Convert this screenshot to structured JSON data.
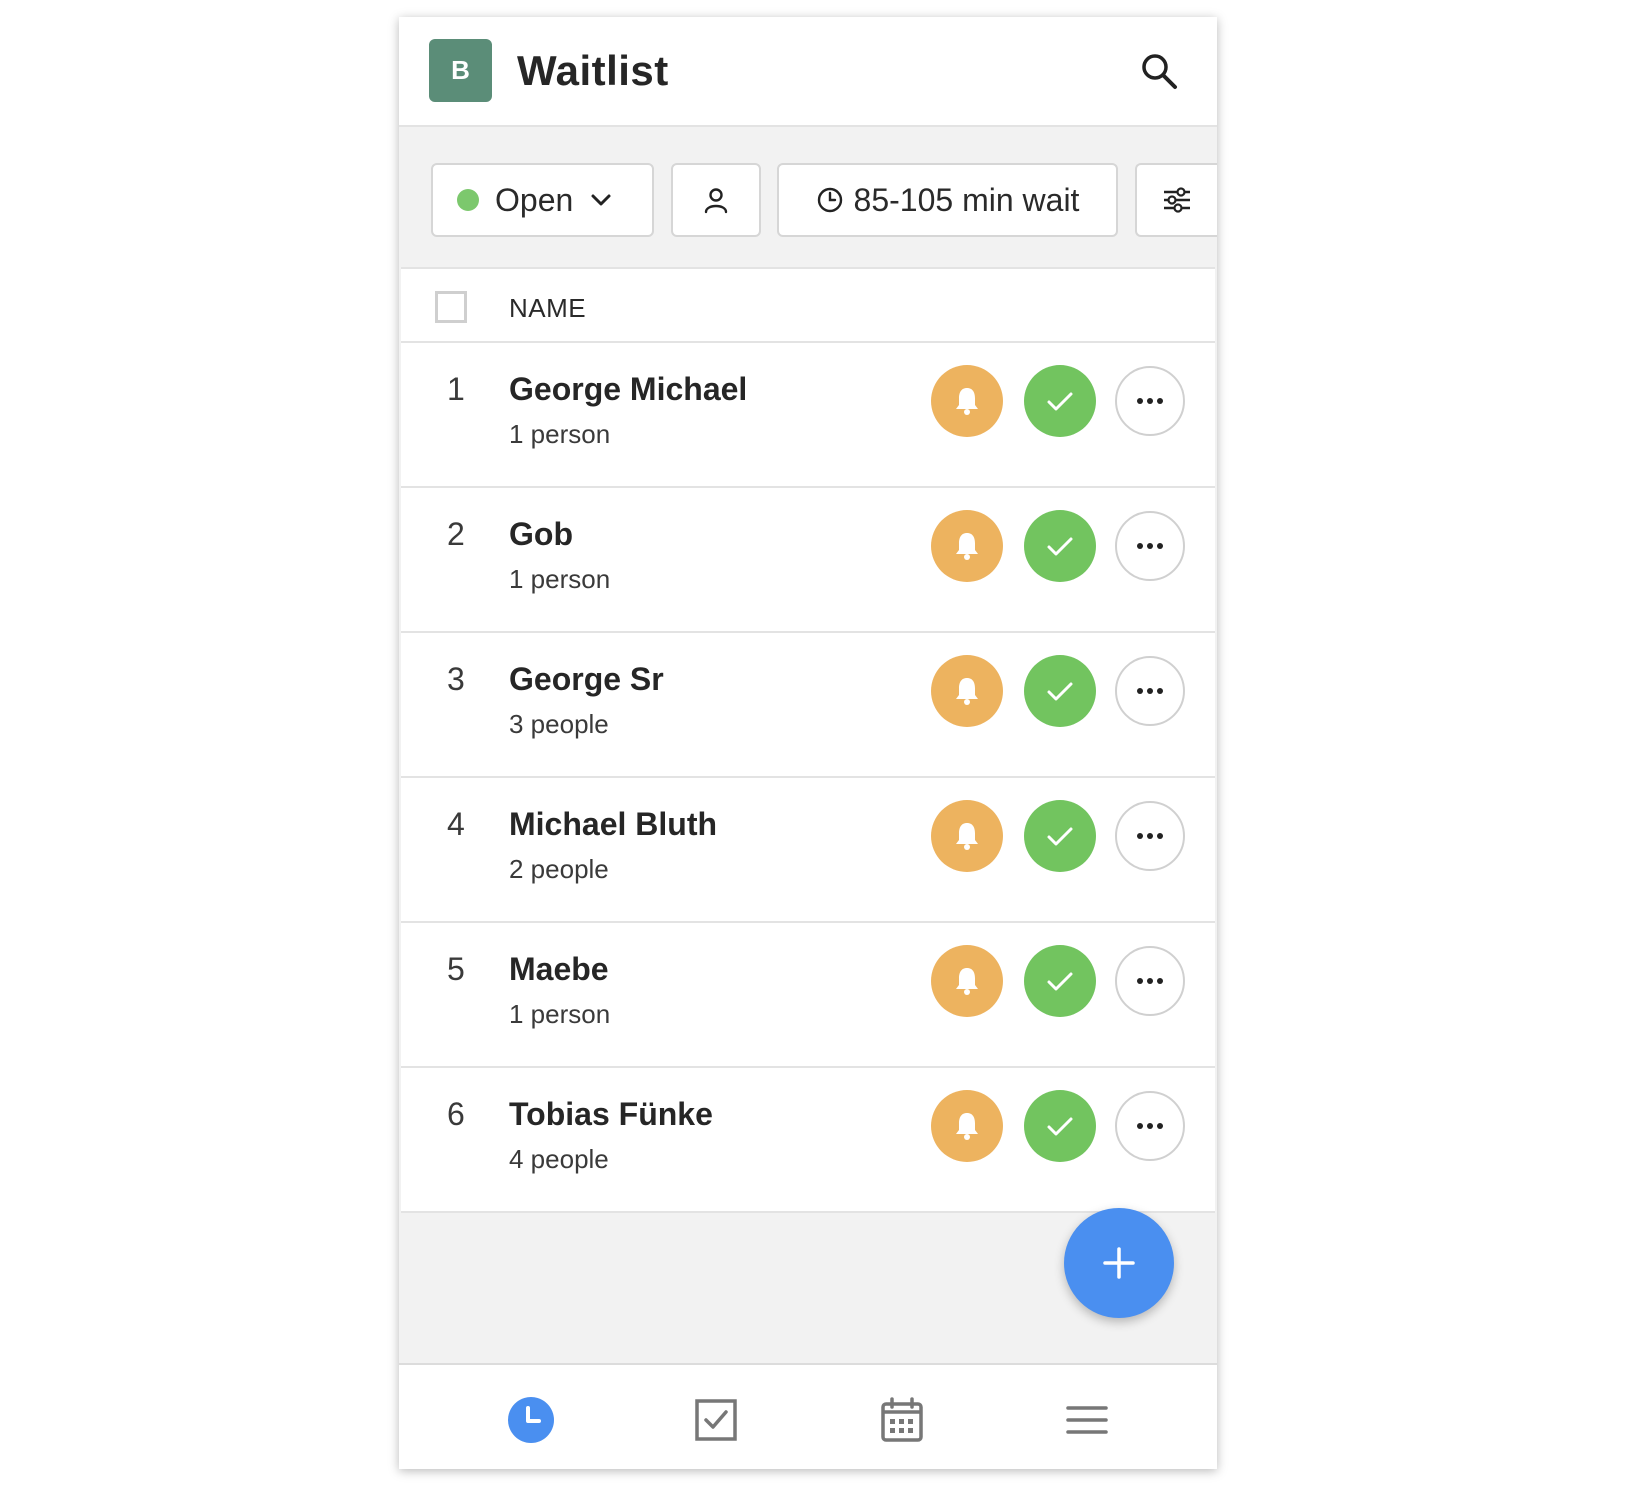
{
  "app": {
    "logo_letter": "B",
    "title": "Waitlist"
  },
  "toolbar": {
    "status_label": "Open",
    "status_color": "#7cc86d",
    "wait_label": "85-105 min wait"
  },
  "list": {
    "column_name": "NAME",
    "rows": [
      {
        "num": "1",
        "name": "George Michael",
        "size": "1 person"
      },
      {
        "num": "2",
        "name": "Gob",
        "size": "1 person"
      },
      {
        "num": "3",
        "name": "George Sr",
        "size": "3 people"
      },
      {
        "num": "4",
        "name": "Michael Bluth",
        "size": "2 people"
      },
      {
        "num": "5",
        "name": "Maebe",
        "size": "1 person"
      },
      {
        "num": "6",
        "name": "Tobias Fünke",
        "size": "4 people"
      }
    ]
  },
  "colors": {
    "brand": "#5b8d78",
    "notify": "#edb35f",
    "seat": "#72c45f",
    "accent": "#4a8ff0"
  },
  "icons": {
    "row_actions": [
      "bell-icon",
      "check-icon",
      "more-icon"
    ],
    "nav": [
      "clock-icon",
      "checkbox-icon",
      "calendar-icon",
      "menu-icon"
    ]
  }
}
